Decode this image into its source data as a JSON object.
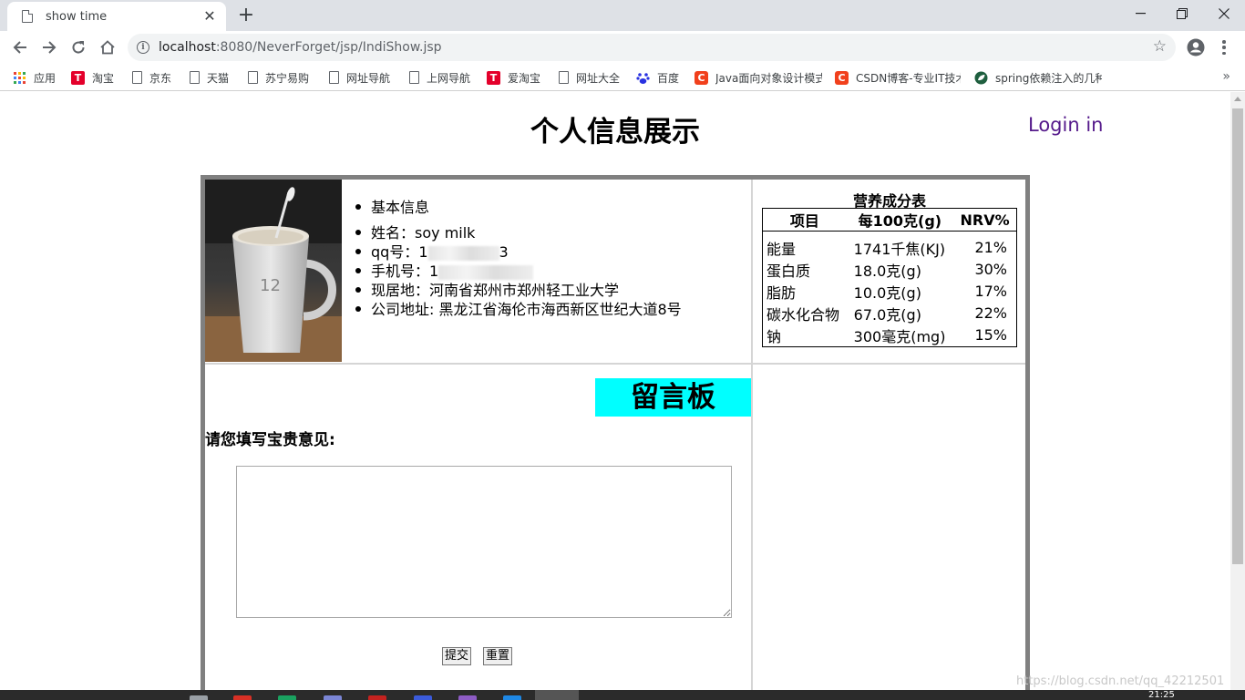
{
  "browser": {
    "tab_title": "show time",
    "tab_close": "✕",
    "new_tab": "+",
    "url_host": "localhost",
    "url_rest": ":8080/NeverForget/jsp/IndiShow.jsp"
  },
  "bookmarks": [
    {
      "label": "应用",
      "icon": "apps-grid-icon"
    },
    {
      "label": "淘宝",
      "icon": "taobao-icon"
    },
    {
      "label": "京东",
      "icon": "page-icon"
    },
    {
      "label": "天猫",
      "icon": "page-icon"
    },
    {
      "label": "苏宁易购",
      "icon": "page-icon"
    },
    {
      "label": "网址导航",
      "icon": "page-icon"
    },
    {
      "label": "上网导航",
      "icon": "page-icon"
    },
    {
      "label": "爱淘宝",
      "icon": "taobao-icon"
    },
    {
      "label": "网址大全",
      "icon": "page-icon"
    },
    {
      "label": "百度",
      "icon": "baidu-paw-icon"
    },
    {
      "label": "Java面向对象设计模式",
      "icon": "csdn-icon"
    },
    {
      "label": "CSDN博客-专业IT技术",
      "icon": "csdn-icon"
    },
    {
      "label": "spring依赖注入的几种",
      "icon": "leaf-icon"
    }
  ],
  "bookmarks_more": "»",
  "page": {
    "title": "个人信息展示",
    "login_link": "Login in"
  },
  "profile": {
    "section_heading": "基本信息",
    "name_label": "姓名：",
    "name_value": "soy milk",
    "qq_label": "qq号：",
    "qq_value_start": "1",
    "qq_value_end": "3",
    "phone_label": "手机号：",
    "phone_value_start": "1",
    "address_label": "现居地：",
    "address_value": "河南省郑州市郑州轻工业大学",
    "company_label": "公司地址: ",
    "company_value": "黑龙江省海伦市海西新区世纪大道8号"
  },
  "nutrition": {
    "caption": "营养成分表",
    "headers": [
      "项目",
      "每100克(g)",
      "NRV%"
    ],
    "rows": [
      [
        "能量",
        "1741千焦(KJ)",
        "21%"
      ],
      [
        "蛋白质",
        "18.0克(g)",
        "30%"
      ],
      [
        "脂肪",
        "10.0克(g)",
        "17%"
      ],
      [
        "碳水化合物",
        "67.0克(g)",
        "22%"
      ],
      [
        "钠",
        "300毫克(mg)",
        "15%"
      ]
    ]
  },
  "message_board": {
    "title": "留言板",
    "prompt": "请您填写宝贵意见:",
    "textarea_value": "",
    "submit_label": "提交",
    "reset_label": "重置"
  },
  "taskbar": {
    "clock": "21:25"
  },
  "watermark": "https://blog.csdn.net/qq_42212501",
  "colors": {
    "board_title_bg": "#00ffff",
    "login_link": "#551a8b",
    "outer_border": "#808080"
  }
}
